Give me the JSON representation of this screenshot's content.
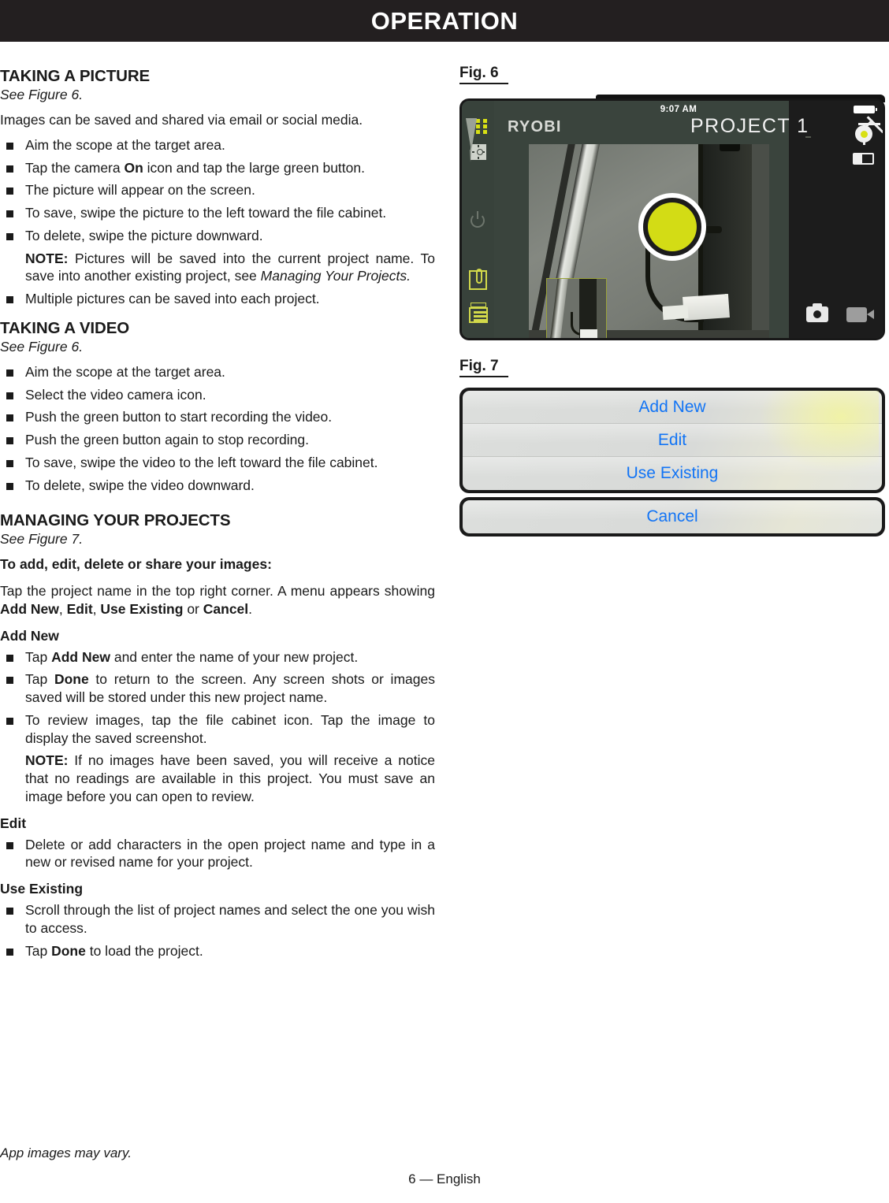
{
  "header": {
    "title": "OPERATION"
  },
  "left_column": {
    "taking_picture": {
      "heading": "TAKING A PICTURE",
      "see_figure": "See Figure 6.",
      "intro": "Images can be saved and shared via email or social media.",
      "bullets": [
        "Aim the scope at the target area.",
        "Tap the camera On icon and tap the large green button.",
        "The picture will appear on the screen.",
        "To save, swipe the picture to the left toward the file cabinet.",
        "To delete, swipe the picture downward.",
        "Multiple pictures can be saved into each project."
      ],
      "note_label": "NOTE:",
      "note_text": "Pictures will be saved into the current project name. To save into another existing project, see",
      "note_italic": "Managing Your Projects."
    },
    "taking_video": {
      "heading": "TAKING A VIDEO",
      "see_figure": "See Figure 6.",
      "bullets": [
        "Aim the scope at the target area.",
        "Select the video camera icon.",
        "Push the green button to start recording the video.",
        "Push the green button again to stop recording.",
        "To save, swipe the video to the left toward the file cabinet.",
        "To delete, swipe the video downward."
      ]
    },
    "managing_projects": {
      "heading": "MANAGING YOUR PROJECTS",
      "see_figure": "See Figure 7.",
      "lead_bold": "To add, edit, delete or share your images:",
      "lead_text_1": "Tap the project name in the top right corner. A menu appears showing",
      "lead_menu": [
        "Add New",
        "Edit",
        "Use Existing",
        "Cancel"
      ],
      "lead_or": "or",
      "add_new": {
        "heading": "Add New",
        "b1_pre": "Tap",
        "b1_bold": "Add New",
        "b1_post": "and enter the name of your new project.",
        "b2_pre": "Tap",
        "b2_bold": "Done",
        "b2_post": "to return to the screen. Any screen shots or images saved will be stored under this new project name.",
        "b3": "To review images, tap the file cabinet icon. Tap the image to display the saved screenshot.",
        "note_label": "NOTE:",
        "note_text": "If no images have been saved, you will receive a notice that no readings are available in this project. You must save an image before you can open to review."
      },
      "edit": {
        "heading": "Edit",
        "b1": "Delete or add characters in the open project name and type in a new or revised name for your project."
      },
      "use_existing": {
        "heading": "Use Existing",
        "b1": "Scroll through the list of project names and select the one you wish to access.",
        "b2_pre": "Tap",
        "b2_bold": "Done",
        "b2_post": "to load the project."
      }
    }
  },
  "figures": {
    "fig6": {
      "label": "Fig. 6",
      "device": {
        "status_time": "9:07 AM",
        "brand": "RYOBI",
        "project_name": "PROJECT 1",
        "accent_color": "#d3dc15",
        "body_color": "#3a443d",
        "panel_color": "#1c1c1c",
        "icons": [
          "grid-icon",
          "brightness-icon",
          "power-icon",
          "attachment-icon",
          "file-cabinet-icon",
          "battery-icon",
          "gear-icon",
          "contrast-icon",
          "shutter-button",
          "camera-icon",
          "video-camera-icon"
        ]
      }
    },
    "fig7": {
      "label": "Fig. 7",
      "menu_items": [
        "Add New",
        "Edit",
        "Use Existing"
      ],
      "cancel_item": "Cancel",
      "text_color": "#1274f5"
    }
  },
  "footer": {
    "note": "App images may vary.",
    "page": "6 — English"
  }
}
